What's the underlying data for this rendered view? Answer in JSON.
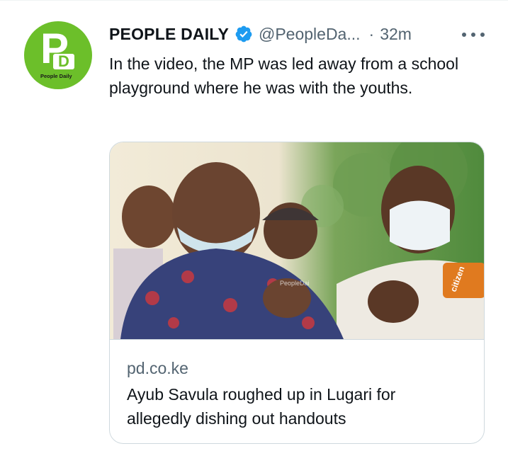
{
  "tweet": {
    "author": {
      "display_name": "PEOPLE DAILY",
      "handle": "@PeopleDa...",
      "verified": true,
      "avatar_logo_text": "People Daily",
      "avatar_letters": [
        "P",
        "D"
      ]
    },
    "separator": "·",
    "time": "32m",
    "text": "In the video, the MP was led away from a school playground where he was with the youths.",
    "card": {
      "domain": "pd.co.ke",
      "title": "Ayub Savula roughed up in Lugari for allegedly dishing out handouts",
      "image_watermark": "PeopleDai",
      "image_mic_label": "citizen"
    }
  },
  "colors": {
    "brand_green": "#6cbf2a",
    "verified_blue": "#1d9bf0",
    "secondary_text": "#536471",
    "border": "#cfd9de"
  },
  "icons": [
    "verified-badge-icon",
    "more-options-icon"
  ]
}
